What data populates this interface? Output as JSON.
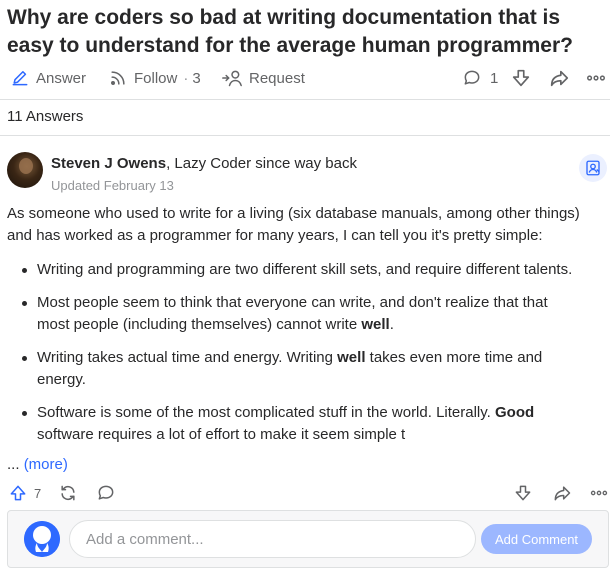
{
  "question": {
    "title": "Why are coders so bad at writing documentation that is easy to understand for the average human programmer?"
  },
  "question_actions": {
    "answer_label": "Answer",
    "follow_label": "Follow",
    "follow_count": "3",
    "follow_separator": "·",
    "request_label": "Request",
    "comments_count": "1"
  },
  "answers_count_label": "11 Answers",
  "answer": {
    "author_name": "Steven J Owens",
    "author_credential": ", Lazy Coder since way back",
    "updated": "Updated February 13",
    "intro": "As someone who used to write for a living (six database manuals, among other things) and has worked as a programmer for many years, I can tell you it's pretty simple:",
    "bullets": [
      {
        "pre": "Writing and programming are two different skill sets, and require different talents.",
        "bold": "",
        "post": ""
      },
      {
        "pre": "Most people seem to think that everyone can write, and don't realize that that most people (including themselves) cannot write ",
        "bold": "well",
        "post": "."
      },
      {
        "pre": "Writing takes actual time and energy. Writing ",
        "bold": "well",
        "post": " takes even more time and energy."
      },
      {
        "pre": "Software is some of the most complicated stuff in the world. Literally. ",
        "bold": "Good",
        "post": " software requires a lot of effort to make it seem simple t"
      }
    ],
    "ellipsis": "...",
    "more_label": "(more)",
    "upvote_count": "7"
  },
  "comment_box": {
    "placeholder": "Add a comment...",
    "button_label": "Add Comment"
  },
  "colors": {
    "link": "#2e69ff",
    "icon_gray": "#636466",
    "button_disabled": "#9cb7ff"
  }
}
